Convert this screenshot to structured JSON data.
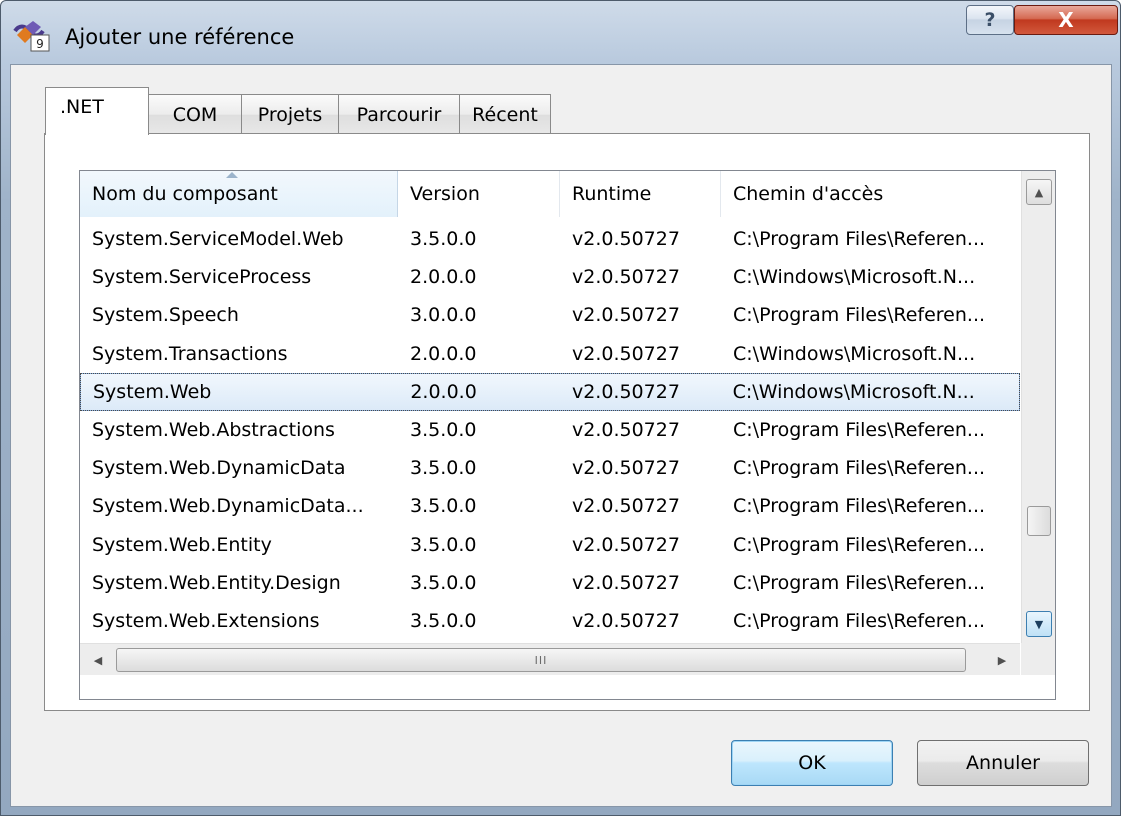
{
  "window": {
    "title": "Ajouter une référence",
    "help_label": "?",
    "close_label": "X"
  },
  "tabs": [
    {
      "label": ".NET",
      "active": true
    },
    {
      "label": "COM",
      "active": false
    },
    {
      "label": "Projets",
      "active": false
    },
    {
      "label": "Parcourir",
      "active": false
    },
    {
      "label": "Récent",
      "active": false
    }
  ],
  "list": {
    "columns": [
      "Nom du composant",
      "Version",
      "Runtime",
      "Chemin d'accès"
    ],
    "sorted_column": "Nom du composant",
    "rows": [
      [
        "System.ServiceModel.Web",
        "3.5.0.0",
        "v2.0.50727",
        "C:\\Program Files\\Referen..."
      ],
      [
        "System.ServiceProcess",
        "2.0.0.0",
        "v2.0.50727",
        "C:\\Windows\\Microsoft.N..."
      ],
      [
        "System.Speech",
        "3.0.0.0",
        "v2.0.50727",
        "C:\\Program Files\\Referen..."
      ],
      [
        "System.Transactions",
        "2.0.0.0",
        "v2.0.50727",
        "C:\\Windows\\Microsoft.N..."
      ],
      [
        "System.Web",
        "2.0.0.0",
        "v2.0.50727",
        "C:\\Windows\\Microsoft.N..."
      ],
      [
        "System.Web.Abstractions",
        "3.5.0.0",
        "v2.0.50727",
        "C:\\Program Files\\Referen..."
      ],
      [
        "System.Web.DynamicData",
        "3.5.0.0",
        "v2.0.50727",
        "C:\\Program Files\\Referen..."
      ],
      [
        "System.Web.DynamicData...",
        "3.5.0.0",
        "v2.0.50727",
        "C:\\Program Files\\Referen..."
      ],
      [
        "System.Web.Entity",
        "3.5.0.0",
        "v2.0.50727",
        "C:\\Program Files\\Referen..."
      ],
      [
        "System.Web.Entity.Design",
        "3.5.0.0",
        "v2.0.50727",
        "C:\\Program Files\\Referen..."
      ],
      [
        "System.Web.Extensions",
        "3.5.0.0",
        "v2.0.50727",
        "C:\\Program Files\\Referen..."
      ]
    ],
    "selected_row": 4,
    "hscroll_grip": "III"
  },
  "buttons": {
    "ok": "OK",
    "cancel": "Annuler"
  },
  "icons": {
    "app": "visual-studio-2008-icon",
    "scroll_up": "scroll-up-arrow-icon",
    "scroll_down": "scroll-down-arrow-icon",
    "scroll_left": "scroll-left-arrow-icon",
    "scroll_right": "scroll-right-arrow-icon"
  },
  "colors": {
    "selection": "#dceaf8",
    "close_button": "#c0391f",
    "default_button_border": "#3c7fb1"
  }
}
